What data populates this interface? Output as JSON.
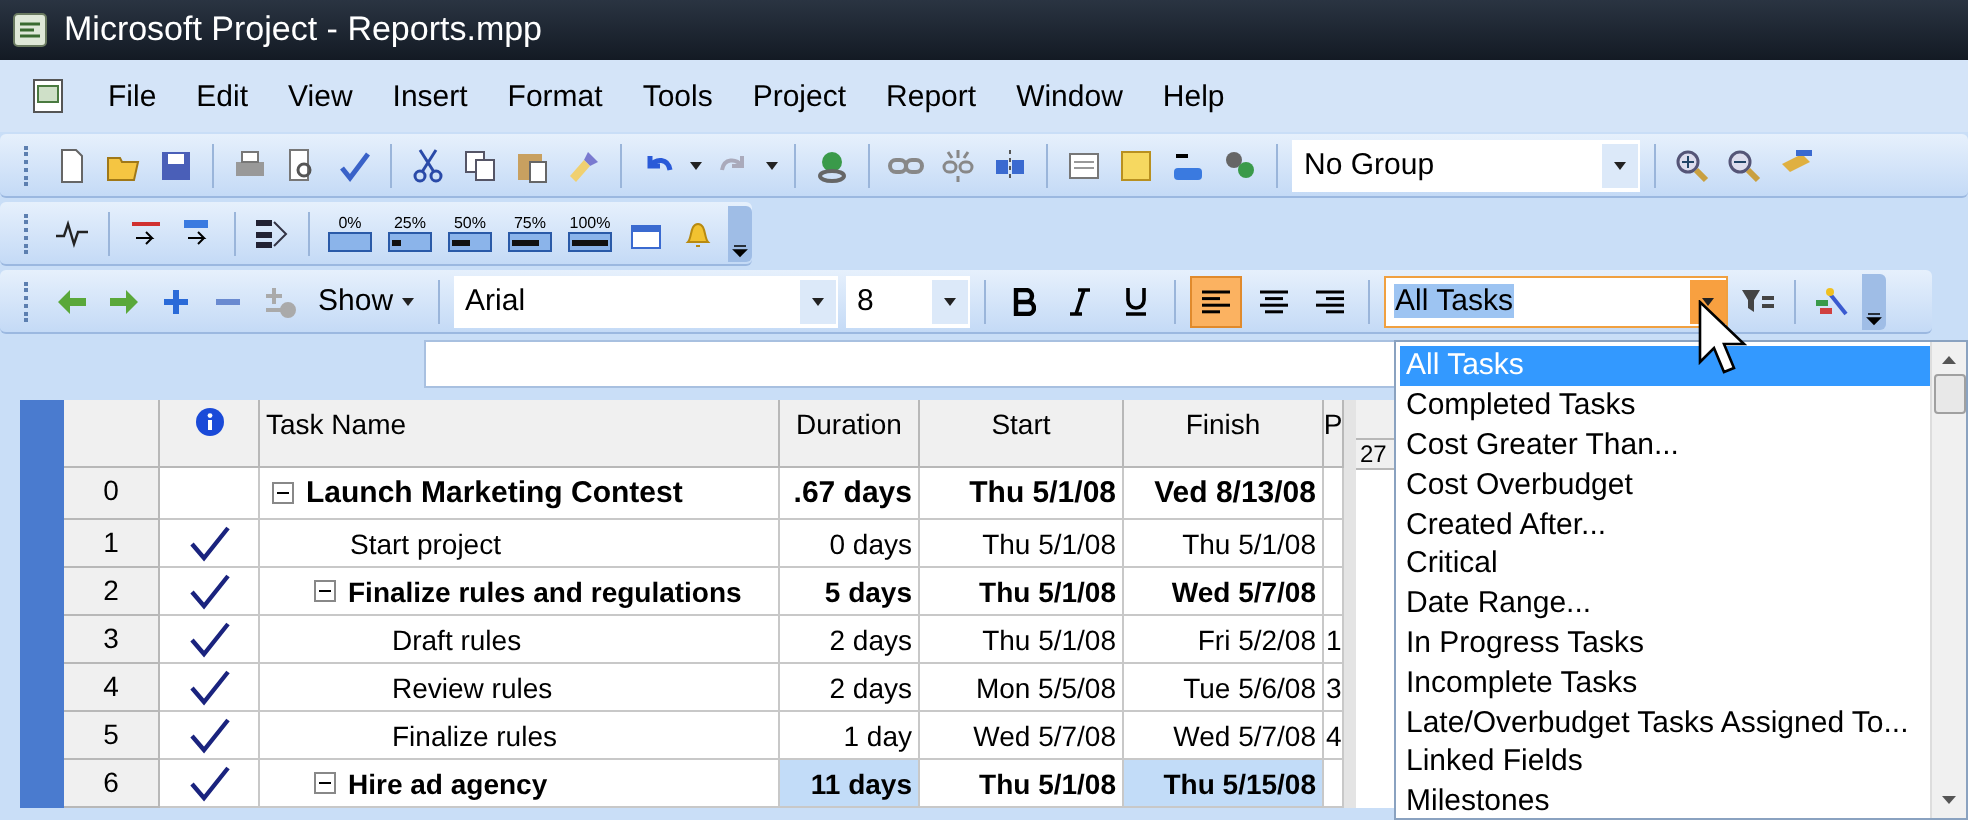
{
  "window": {
    "title": "Microsoft Project - Reports.mpp"
  },
  "menu": [
    "File",
    "Edit",
    "View",
    "Insert",
    "Format",
    "Tools",
    "Project",
    "Report",
    "Window",
    "Help"
  ],
  "group_box": {
    "value": "No Group"
  },
  "progress_buttons": [
    "0%",
    "25%",
    "50%",
    "75%",
    "100%"
  ],
  "formatting": {
    "show_label": "Show",
    "font": "Arial",
    "font_size": "8",
    "align": [
      {
        "kind": "left",
        "selected": true
      },
      {
        "kind": "center",
        "selected": false
      },
      {
        "kind": "right",
        "selected": false
      }
    ],
    "filter": {
      "value": "All Tasks",
      "expanded": true
    }
  },
  "filter_options": [
    {
      "label": "All Tasks",
      "selected": true
    },
    {
      "label": "Completed Tasks",
      "selected": false
    },
    {
      "label": "Cost Greater Than...",
      "selected": false
    },
    {
      "label": "Cost Overbudget",
      "selected": false
    },
    {
      "label": "Created After...",
      "selected": false
    },
    {
      "label": "Critical",
      "selected": false
    },
    {
      "label": "Date Range...",
      "selected": false
    },
    {
      "label": "In Progress Tasks",
      "selected": false
    },
    {
      "label": "Incomplete Tasks",
      "selected": false
    },
    {
      "label": "Late/Overbudget Tasks Assigned To...",
      "selected": false
    },
    {
      "label": "Linked Fields",
      "selected": false
    },
    {
      "label": "Milestones",
      "selected": false
    }
  ],
  "table": {
    "columns": [
      "Task Name",
      "Duration",
      "Start",
      "Finish",
      "P"
    ],
    "timescale": "27",
    "rows": [
      {
        "id": "0",
        "kind": "project",
        "complete": false,
        "expanded": true,
        "name": "Launch Marketing Contest",
        "duration": ".67 days",
        "start": "Thu 5/1/08",
        "finish": "Ved 8/13/08",
        "duration_selected": false,
        "finish_selected": false,
        "children": [
          {
            "id": "1",
            "kind": "task",
            "complete": true,
            "name": "Start project",
            "duration": "0 days",
            "start": "Thu 5/1/08",
            "finish": "Thu 5/1/08",
            "duration_selected": false,
            "finish_selected": false
          },
          {
            "id": "2",
            "kind": "summary",
            "complete": true,
            "expanded": true,
            "name": "Finalize rules and regulations",
            "duration": "5 days",
            "start": "Thu 5/1/08",
            "finish": "Wed 5/7/08",
            "duration_selected": false,
            "finish_selected": false,
            "children": [
              {
                "id": "3",
                "kind": "task",
                "complete": true,
                "name": "Draft rules",
                "duration": "2 days",
                "start": "Thu 5/1/08",
                "finish": "Fri 5/2/08",
                "predecessors": "1",
                "duration_selected": false,
                "finish_selected": false
              },
              {
                "id": "4",
                "kind": "task",
                "complete": true,
                "name": "Review rules",
                "duration": "2 days",
                "start": "Mon 5/5/08",
                "finish": "Tue 5/6/08",
                "predecessors": "3",
                "duration_selected": false,
                "finish_selected": false
              },
              {
                "id": "5",
                "kind": "task",
                "complete": true,
                "name": "Finalize rules",
                "duration": "1 day",
                "start": "Wed 5/7/08",
                "finish": "Wed 5/7/08",
                "predecessors": "4",
                "duration_selected": false,
                "finish_selected": false
              }
            ]
          },
          {
            "id": "6",
            "kind": "summary",
            "complete": true,
            "expanded": true,
            "name": "Hire ad agency",
            "duration": "11 days",
            "start": "Thu 5/1/08",
            "finish": "Thu 5/15/08",
            "duration_selected": true,
            "finish_selected": true
          }
        ]
      }
    ]
  }
}
